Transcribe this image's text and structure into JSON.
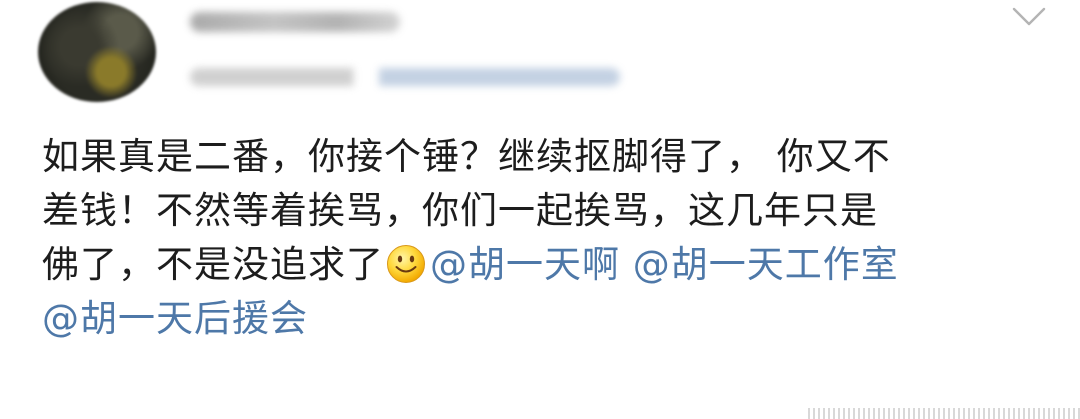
{
  "post": {
    "author_avatar": "user-avatar",
    "text_lines": [
      "如果真是二番，你接个锤？继续抠脚得了， 你又不",
      "差钱！不然等着挨骂，你们一起挨骂，这几年只是",
      "佛了，不是没追求了"
    ],
    "emoji": "smiley-face",
    "mentions": [
      "@胡一天啊",
      "@胡一天工作室",
      "@胡一天后援会"
    ]
  },
  "icons": {
    "menu_toggle": "chevron-down-icon"
  },
  "colors": {
    "text": "#1d1d1d",
    "mention": "#4e78a8",
    "background": "#ffffff"
  }
}
